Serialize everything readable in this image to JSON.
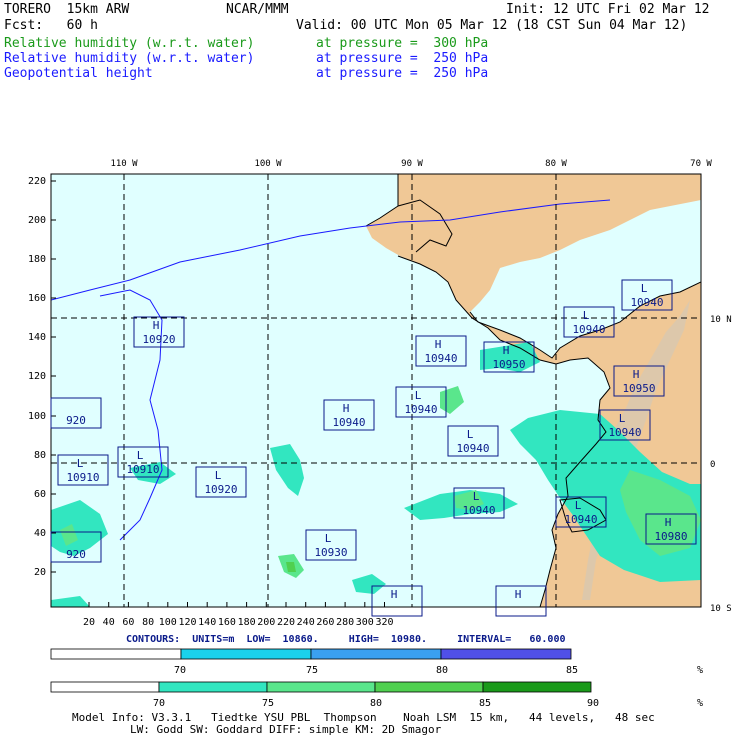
{
  "header": {
    "model": "TORERO  15km ARW",
    "center": "NCAR/MMM",
    "init": "Init: 12 UTC Fri 02 Mar 12",
    "fcst": "Fcst:   60 h",
    "valid": "Valid: 00 UTC Mon 05 Mar 12 (18 CST Sun 04 Mar 12)",
    "fields": [
      {
        "name": "Relative humidity (w.r.t. water)",
        "level": "at pressure =  300 hPa",
        "color": "#1a9a1a"
      },
      {
        "name": "Relative humidity (w.r.t. water)",
        "level": "at pressure =  250 hPa",
        "color": "#1a1aff"
      },
      {
        "name": "Geopotential height",
        "level": "at pressure =  250 hPa",
        "color": "#000000"
      }
    ]
  },
  "map": {
    "lon_labels": [
      "110 W",
      "100 W",
      "90 W",
      "80 W",
      "70 W"
    ],
    "lat_labels": [
      "10 N",
      "0",
      "10 S"
    ],
    "y_ticks": [
      "220",
      "200",
      "180",
      "160",
      "140",
      "120",
      "100",
      "80",
      "60",
      "40",
      "20"
    ],
    "x_ticks": [
      "20",
      "40",
      "60",
      "80",
      "100",
      "120",
      "140",
      "160",
      "180",
      "200",
      "220",
      "240",
      "260",
      "280",
      "300",
      "320"
    ],
    "ocean_color": "#e0ffff",
    "land_color": "#f0c896",
    "centers": [
      {
        "label": "H",
        "value": "10920"
      },
      {
        "label": "H",
        "value": "10940"
      },
      {
        "label": "H",
        "value": "10950"
      },
      {
        "label": "L",
        "value": "10940"
      },
      {
        "label": "L",
        "value": "10940"
      },
      {
        "label": "L",
        "value": "10940"
      },
      {
        "label": "H",
        "value": "10940"
      },
      {
        "label": "L",
        "value": "10910"
      },
      {
        "label": "L",
        "value": "10910"
      },
      {
        "label": "L",
        "value": "10920"
      },
      {
        "label": "L",
        "value": "10940"
      },
      {
        "label": "L",
        "value": "10930"
      },
      {
        "label": "L",
        "value": "10940"
      },
      {
        "label": "H",
        "value": "10950"
      },
      {
        "label": "L",
        "value": "10940"
      },
      {
        "label": "L",
        "value": "10940"
      },
      {
        "label": "H",
        "value": "10980"
      },
      {
        "label": "H",
        "value": ""
      },
      {
        "label": "H",
        "value": ""
      },
      {
        "label": "",
        "value": "920"
      },
      {
        "label": "",
        "value": "920"
      }
    ]
  },
  "contours_line": "CONTOURS:  UNITS=m  LOW=  10860.     HIGH=  10980.     INTERVAL=   60.000",
  "colorbars": [
    {
      "labels": [
        "70",
        "75",
        "80",
        "85"
      ],
      "colors": [
        "#ffffff",
        "#1ad2ec",
        "#3aa0f0",
        "#5050e8"
      ],
      "unit": "%"
    },
    {
      "labels": [
        "70",
        "75",
        "80",
        "85",
        "90"
      ],
      "colors": [
        "#ffffff",
        "#32e6c0",
        "#5ae68c",
        "#50d050",
        "#1a9a1a"
      ],
      "unit": "%"
    }
  ],
  "footer": {
    "line1": "Model Info: V3.3.1   Tiedtke YSU PBL  Thompson    Noah LSM  15 km,   44 levels,   48 sec",
    "line2": "LW: Godd SW: Goddard DIFF: simple KM: 2D Smagor"
  }
}
